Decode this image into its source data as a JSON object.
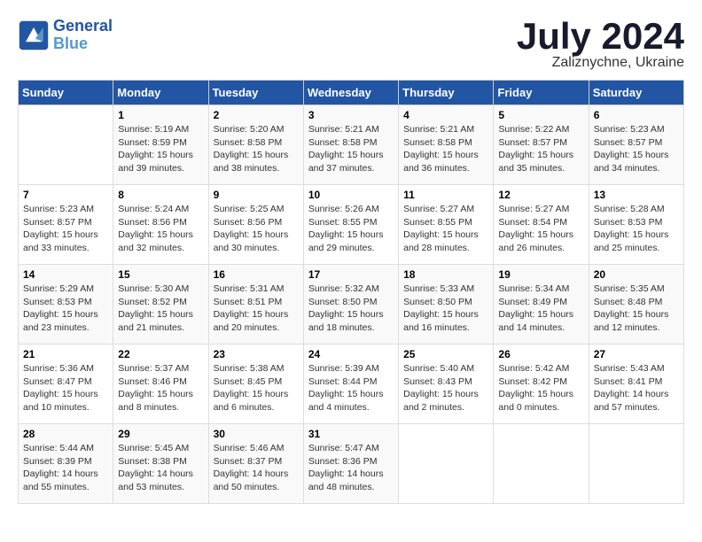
{
  "header": {
    "logo_line1": "General",
    "logo_line2": "Blue",
    "month_title": "July 2024",
    "location": "Zaliznychne, Ukraine"
  },
  "weekdays": [
    "Sunday",
    "Monday",
    "Tuesday",
    "Wednesday",
    "Thursday",
    "Friday",
    "Saturday"
  ],
  "weeks": [
    [
      {
        "day": "",
        "sunrise": "",
        "sunset": "",
        "daylight": ""
      },
      {
        "day": "1",
        "sunrise": "Sunrise: 5:19 AM",
        "sunset": "Sunset: 8:59 PM",
        "daylight": "Daylight: 15 hours and 39 minutes."
      },
      {
        "day": "2",
        "sunrise": "Sunrise: 5:20 AM",
        "sunset": "Sunset: 8:58 PM",
        "daylight": "Daylight: 15 hours and 38 minutes."
      },
      {
        "day": "3",
        "sunrise": "Sunrise: 5:21 AM",
        "sunset": "Sunset: 8:58 PM",
        "daylight": "Daylight: 15 hours and 37 minutes."
      },
      {
        "day": "4",
        "sunrise": "Sunrise: 5:21 AM",
        "sunset": "Sunset: 8:58 PM",
        "daylight": "Daylight: 15 hours and 36 minutes."
      },
      {
        "day": "5",
        "sunrise": "Sunrise: 5:22 AM",
        "sunset": "Sunset: 8:57 PM",
        "daylight": "Daylight: 15 hours and 35 minutes."
      },
      {
        "day": "6",
        "sunrise": "Sunrise: 5:23 AM",
        "sunset": "Sunset: 8:57 PM",
        "daylight": "Daylight: 15 hours and 34 minutes."
      }
    ],
    [
      {
        "day": "7",
        "sunrise": "Sunrise: 5:23 AM",
        "sunset": "Sunset: 8:57 PM",
        "daylight": "Daylight: 15 hours and 33 minutes."
      },
      {
        "day": "8",
        "sunrise": "Sunrise: 5:24 AM",
        "sunset": "Sunset: 8:56 PM",
        "daylight": "Daylight: 15 hours and 32 minutes."
      },
      {
        "day": "9",
        "sunrise": "Sunrise: 5:25 AM",
        "sunset": "Sunset: 8:56 PM",
        "daylight": "Daylight: 15 hours and 30 minutes."
      },
      {
        "day": "10",
        "sunrise": "Sunrise: 5:26 AM",
        "sunset": "Sunset: 8:55 PM",
        "daylight": "Daylight: 15 hours and 29 minutes."
      },
      {
        "day": "11",
        "sunrise": "Sunrise: 5:27 AM",
        "sunset": "Sunset: 8:55 PM",
        "daylight": "Daylight: 15 hours and 28 minutes."
      },
      {
        "day": "12",
        "sunrise": "Sunrise: 5:27 AM",
        "sunset": "Sunset: 8:54 PM",
        "daylight": "Daylight: 15 hours and 26 minutes."
      },
      {
        "day": "13",
        "sunrise": "Sunrise: 5:28 AM",
        "sunset": "Sunset: 8:53 PM",
        "daylight": "Daylight: 15 hours and 25 minutes."
      }
    ],
    [
      {
        "day": "14",
        "sunrise": "Sunrise: 5:29 AM",
        "sunset": "Sunset: 8:53 PM",
        "daylight": "Daylight: 15 hours and 23 minutes."
      },
      {
        "day": "15",
        "sunrise": "Sunrise: 5:30 AM",
        "sunset": "Sunset: 8:52 PM",
        "daylight": "Daylight: 15 hours and 21 minutes."
      },
      {
        "day": "16",
        "sunrise": "Sunrise: 5:31 AM",
        "sunset": "Sunset: 8:51 PM",
        "daylight": "Daylight: 15 hours and 20 minutes."
      },
      {
        "day": "17",
        "sunrise": "Sunrise: 5:32 AM",
        "sunset": "Sunset: 8:50 PM",
        "daylight": "Daylight: 15 hours and 18 minutes."
      },
      {
        "day": "18",
        "sunrise": "Sunrise: 5:33 AM",
        "sunset": "Sunset: 8:50 PM",
        "daylight": "Daylight: 15 hours and 16 minutes."
      },
      {
        "day": "19",
        "sunrise": "Sunrise: 5:34 AM",
        "sunset": "Sunset: 8:49 PM",
        "daylight": "Daylight: 15 hours and 14 minutes."
      },
      {
        "day": "20",
        "sunrise": "Sunrise: 5:35 AM",
        "sunset": "Sunset: 8:48 PM",
        "daylight": "Daylight: 15 hours and 12 minutes."
      }
    ],
    [
      {
        "day": "21",
        "sunrise": "Sunrise: 5:36 AM",
        "sunset": "Sunset: 8:47 PM",
        "daylight": "Daylight: 15 hours and 10 minutes."
      },
      {
        "day": "22",
        "sunrise": "Sunrise: 5:37 AM",
        "sunset": "Sunset: 8:46 PM",
        "daylight": "Daylight: 15 hours and 8 minutes."
      },
      {
        "day": "23",
        "sunrise": "Sunrise: 5:38 AM",
        "sunset": "Sunset: 8:45 PM",
        "daylight": "Daylight: 15 hours and 6 minutes."
      },
      {
        "day": "24",
        "sunrise": "Sunrise: 5:39 AM",
        "sunset": "Sunset: 8:44 PM",
        "daylight": "Daylight: 15 hours and 4 minutes."
      },
      {
        "day": "25",
        "sunrise": "Sunrise: 5:40 AM",
        "sunset": "Sunset: 8:43 PM",
        "daylight": "Daylight: 15 hours and 2 minutes."
      },
      {
        "day": "26",
        "sunrise": "Sunrise: 5:42 AM",
        "sunset": "Sunset: 8:42 PM",
        "daylight": "Daylight: 15 hours and 0 minutes."
      },
      {
        "day": "27",
        "sunrise": "Sunrise: 5:43 AM",
        "sunset": "Sunset: 8:41 PM",
        "daylight": "Daylight: 14 hours and 57 minutes."
      }
    ],
    [
      {
        "day": "28",
        "sunrise": "Sunrise: 5:44 AM",
        "sunset": "Sunset: 8:39 PM",
        "daylight": "Daylight: 14 hours and 55 minutes."
      },
      {
        "day": "29",
        "sunrise": "Sunrise: 5:45 AM",
        "sunset": "Sunset: 8:38 PM",
        "daylight": "Daylight: 14 hours and 53 minutes."
      },
      {
        "day": "30",
        "sunrise": "Sunrise: 5:46 AM",
        "sunset": "Sunset: 8:37 PM",
        "daylight": "Daylight: 14 hours and 50 minutes."
      },
      {
        "day": "31",
        "sunrise": "Sunrise: 5:47 AM",
        "sunset": "Sunset: 8:36 PM",
        "daylight": "Daylight: 14 hours and 48 minutes."
      },
      {
        "day": "",
        "sunrise": "",
        "sunset": "",
        "daylight": ""
      },
      {
        "day": "",
        "sunrise": "",
        "sunset": "",
        "daylight": ""
      },
      {
        "day": "",
        "sunrise": "",
        "sunset": "",
        "daylight": ""
      }
    ]
  ]
}
